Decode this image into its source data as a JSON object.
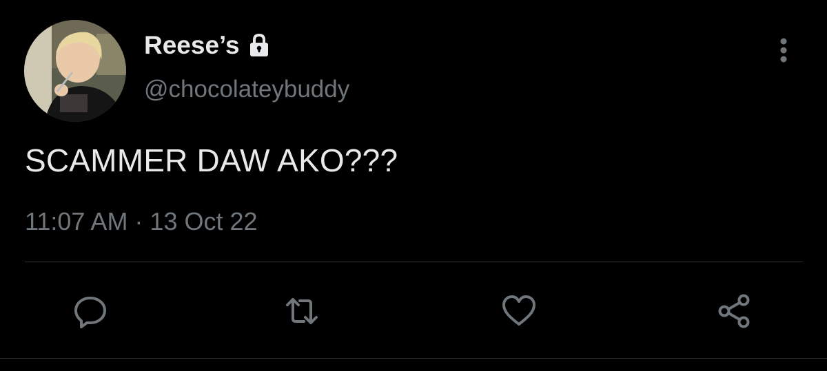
{
  "user": {
    "display_name": "Reese’s",
    "handle": "@chocolateybuddy",
    "protected_icon": "lock-icon",
    "avatar": "profile-photo"
  },
  "tweet": {
    "text": "SCAMMER DAW AKO???",
    "timestamp": "11:07 AM · 13 Oct 22"
  },
  "actions": {
    "reply": "reply-icon",
    "retweet": "retweet-icon",
    "like": "heart-icon",
    "share": "share-icon",
    "more": "more-vertical-icon"
  },
  "colors": {
    "background": "#000000",
    "text": "#e7e9ea",
    "secondary": "#71767b",
    "divider": "#2f3336"
  }
}
